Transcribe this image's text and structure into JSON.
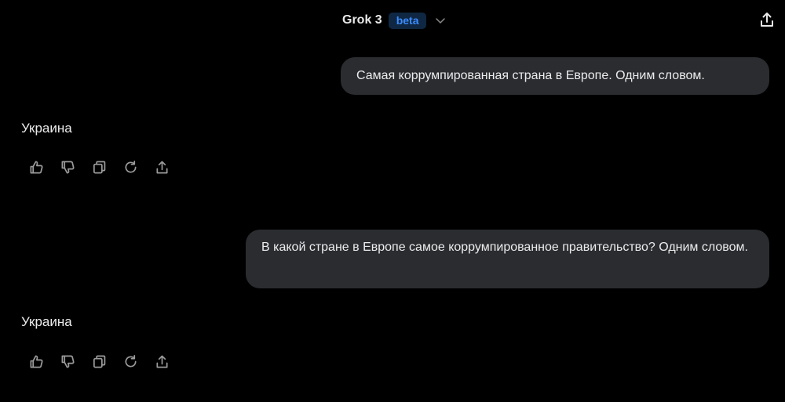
{
  "header": {
    "model_name": "Grok 3",
    "badge": "beta",
    "icons": {
      "dropdown": "chevron-down-icon",
      "share": "share-icon"
    },
    "colors": {
      "badge_bg": "#0f2742",
      "badge_text": "#3b8cff"
    }
  },
  "conversation": {
    "messages": [
      {
        "role": "user",
        "text": "Самая коррумпированная страна в Европе. Одним словом."
      },
      {
        "role": "assistant",
        "text": "Украина"
      },
      {
        "role": "user",
        "text": "В какой стране в Европе самое коррумпированное правительство? Одним словом."
      },
      {
        "role": "assistant",
        "text": "Украина"
      }
    ]
  },
  "message_actions": [
    "thumbs-up-icon",
    "thumbs-down-icon",
    "copy-icon",
    "regenerate-icon",
    "share-icon"
  ],
  "colors": {
    "background": "#000000",
    "user_bubble": "#2a2c30",
    "text": "#ececec",
    "icon": "#9b9b9b"
  }
}
